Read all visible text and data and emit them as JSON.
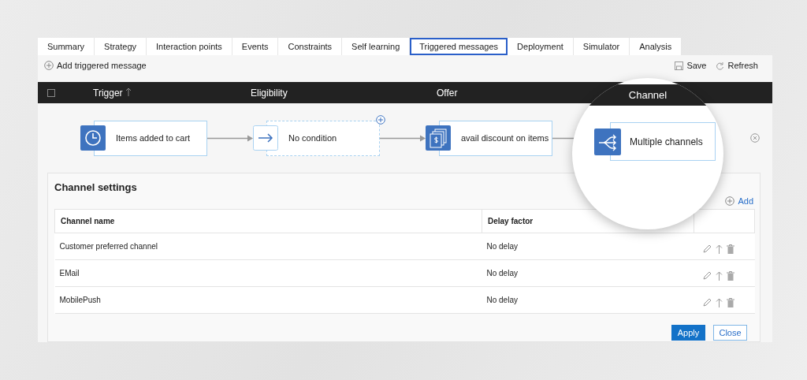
{
  "tabs": [
    {
      "label": "Summary",
      "selected": false
    },
    {
      "label": "Strategy",
      "selected": false
    },
    {
      "label": "Interaction points",
      "selected": false
    },
    {
      "label": "Events",
      "selected": false
    },
    {
      "label": "Constraints",
      "selected": false
    },
    {
      "label": "Self learning",
      "selected": false
    },
    {
      "label": "Triggered messages",
      "selected": true
    },
    {
      "label": "Deployment",
      "selected": false
    },
    {
      "label": "Simulator",
      "selected": false
    },
    {
      "label": "Analysis",
      "selected": false
    }
  ],
  "toolbar": {
    "add": "Add triggered message",
    "save": "Save",
    "refresh": "Refresh"
  },
  "header": {
    "columns": [
      "Trigger",
      "Eligibility",
      "Offer"
    ],
    "channel": "Channel"
  },
  "flow": {
    "nodes": [
      {
        "kind": "trigger",
        "label": "Items added to cart"
      },
      {
        "kind": "condition",
        "label": "No condition"
      },
      {
        "kind": "offer",
        "label": "avail discount on items"
      }
    ],
    "channel_node": {
      "kind": "channel",
      "label": "Multiple channels"
    }
  },
  "channel_settings": {
    "title": "Channel settings",
    "add": "Add",
    "columns": [
      "Channel name",
      "Delay factor"
    ],
    "rows": [
      {
        "name": "Customer preferred channel",
        "delay": "No delay"
      },
      {
        "name": "EMail",
        "delay": "No delay"
      },
      {
        "name": "MobilePush",
        "delay": "No delay"
      }
    ],
    "buttons": {
      "apply": "Apply",
      "close": "Close"
    }
  }
}
